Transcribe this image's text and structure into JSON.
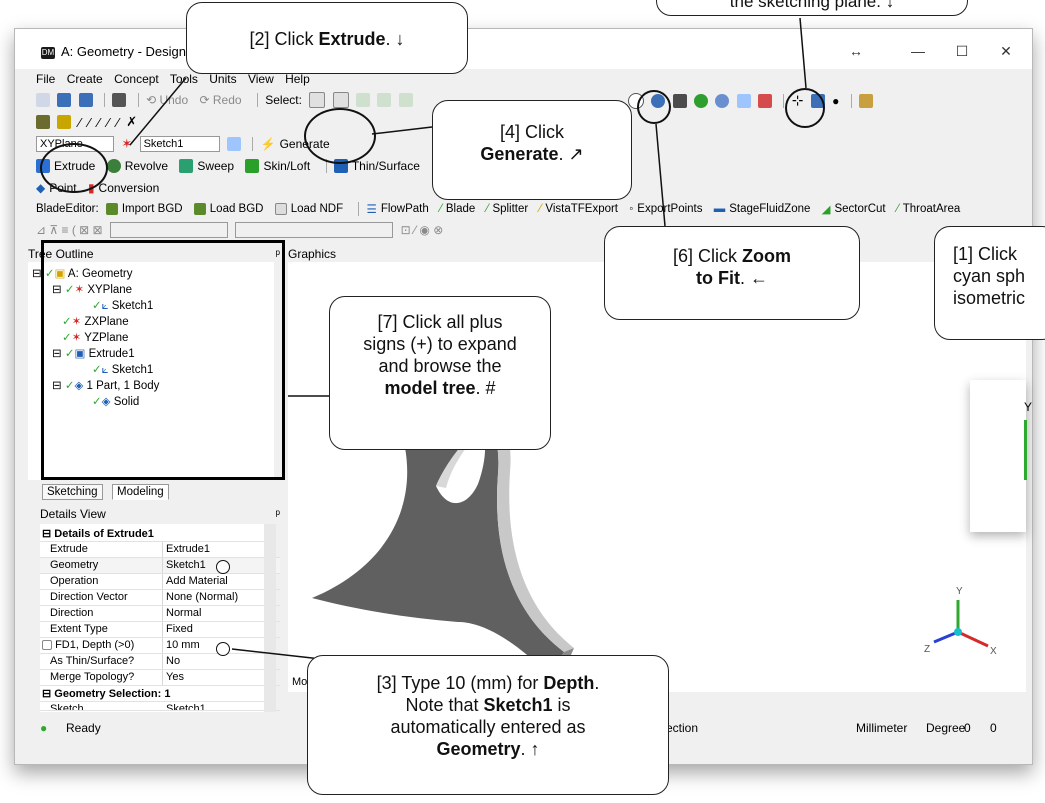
{
  "window": {
    "title": "A: Geometry - DesignMo",
    "app_icon": "DM",
    "resize_glyph": "↔",
    "minimize": "—",
    "maximize": "☐",
    "close": "✕"
  },
  "menu": [
    "File",
    "Create",
    "Concept",
    "Tools",
    "Units",
    "View",
    "Help"
  ],
  "toolbar1": {
    "undo": "Undo",
    "redo": "Redo",
    "select": "Select:"
  },
  "toolbar3": {
    "plane": "XYPlane",
    "sketch": "Sketch1",
    "generate": "Generate"
  },
  "toolbar4": {
    "extrude": "Extrude",
    "revolve": "Revolve",
    "sweep": "Sweep",
    "skinloft": "Skin/Loft",
    "thinsurface": "Thin/Surface"
  },
  "toolbar5": {
    "point": "Point",
    "conversion": "Conversion"
  },
  "bladeeditor": {
    "label": "BladeEditor:",
    "items": [
      "Import BGD",
      "Load BGD",
      "Load NDF",
      "FlowPath",
      "Blade",
      "Splitter",
      "VistaTFExport",
      "ExportPoints",
      "StageFluidZone",
      "SectorCut",
      "ThroatArea"
    ]
  },
  "tree": {
    "header": "Tree Outline",
    "pin": "ᵖ",
    "items": [
      "A: Geometry",
      "XYPlane",
      "Sketch1",
      "ZXPlane",
      "YZPlane",
      "Extrude1",
      "Sketch1",
      "1 Part, 1 Body",
      "Solid"
    ]
  },
  "tabs": [
    "Sketching",
    "Modeling"
  ],
  "details": {
    "header": "Details View",
    "section1": "Details of Extrude1",
    "rows": [
      {
        "k": "Extrude",
        "v": "Extrude1"
      },
      {
        "k": "Geometry",
        "v": "Sketch1"
      },
      {
        "k": "Operation",
        "v": "Add Material"
      },
      {
        "k": "Direction Vector",
        "v": "None (Normal)"
      },
      {
        "k": "Direction",
        "v": "Normal"
      },
      {
        "k": "Extent Type",
        "v": "Fixed"
      },
      {
        "k": "FD1, Depth (>0)",
        "v": "10 mm"
      },
      {
        "k": "As Thin/Surface?",
        "v": "No"
      },
      {
        "k": "Merge Topology?",
        "v": "Yes"
      }
    ],
    "section2": "Geometry Selection: 1",
    "last_row_k": "Sketch",
    "last_row_v": "Sketch1"
  },
  "graphics": {
    "header": "Graphics",
    "axis_y": "Y",
    "axis_z": "Z",
    "axis_x": "X",
    "bottom_tab": "Mo"
  },
  "status": {
    "text": "Ready",
    "selection": "ection",
    "units1": "Millimeter",
    "units2": "Degree",
    "val1": "0",
    "val2": "0"
  },
  "callouts": {
    "c1": "[1] Click",
    "c1b": "cyan sph",
    "c1c": "isometric",
    "c2a": "[2] Click ",
    "c2b": "Extrude",
    "c2c": ". ↓",
    "c3a": "[3] Type 10 (mm) for ",
    "c3b": "Depth",
    "c3c": ".",
    "c3d": "Note that ",
    "c3e": "Sketch1",
    "c3f": " is",
    "c3g": "automatically entered as",
    "c3h": "Geometry",
    "c3i": ". ↑",
    "c4a": "[4] Click",
    "c4b": "Generate",
    "c4c": ". ↗",
    "c5": "the sketching plane. ↓",
    "c6a": "[6] Click ",
    "c6b": "Zoom",
    "c6c": "to Fit",
    "c6d": ". ←",
    "c7a": "[7] Click all plus",
    "c7b": "signs (+) to expand",
    "c7c": "and browse the",
    "c7d": "model tree",
    "c7e": ". #"
  },
  "colors": {
    "accent_blue": "#1f5fb4",
    "axis_green": "#2ea82e",
    "axis_red": "#d42a2a",
    "axis_blue": "#2a3fd4",
    "part_gray": "#5f5f5f"
  }
}
